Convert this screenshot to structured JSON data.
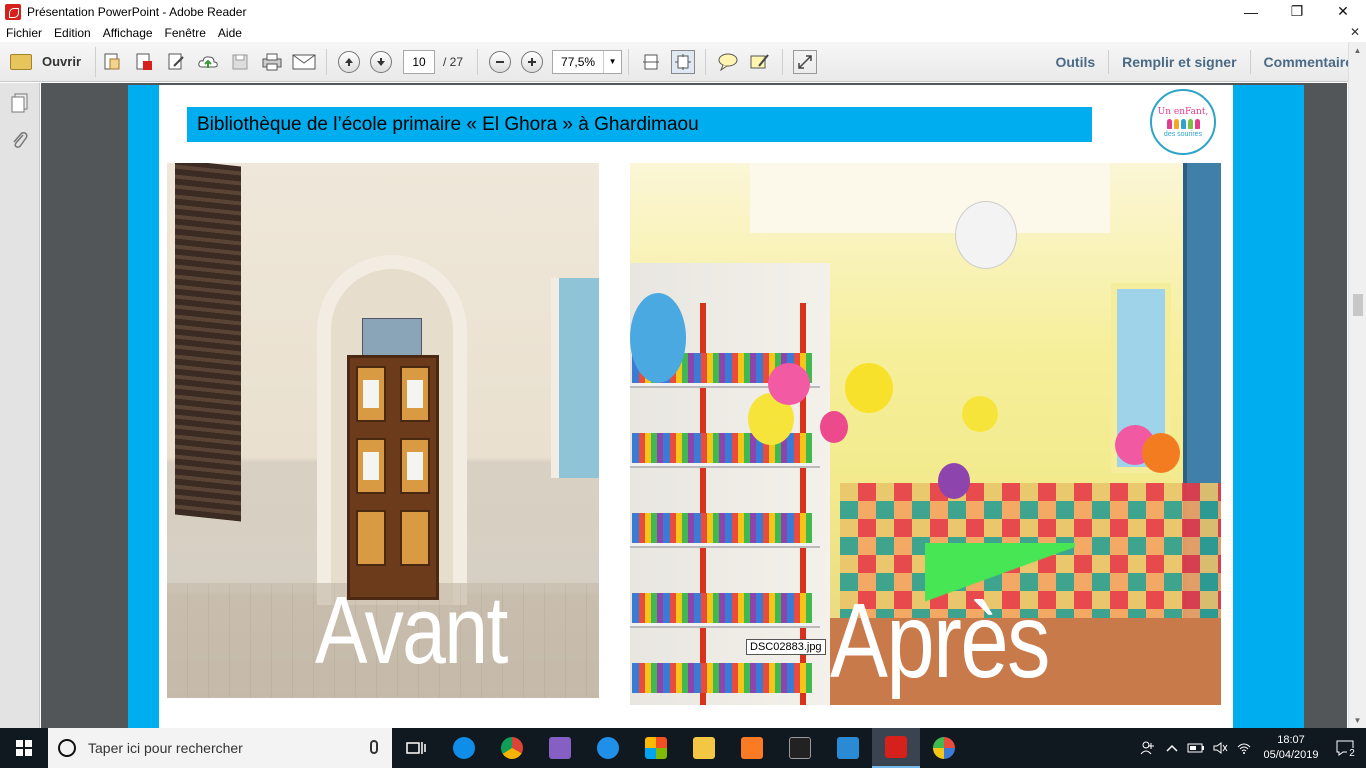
{
  "window": {
    "title": "Présentation PowerPoint - Adobe Reader",
    "minimize": "—",
    "restore": "❐",
    "close": "✕"
  },
  "menu": {
    "items": [
      "Fichier",
      "Edition",
      "Affichage",
      "Fenêtre",
      "Aide"
    ],
    "close_doc": "✕"
  },
  "toolbar": {
    "open_label": "Ouvrir",
    "page_current": "10",
    "page_total": "/ 27",
    "zoom": "77,5%",
    "tools_label": "Outils",
    "fill_sign_label": "Remplir et signer",
    "comment_label": "Commentaire"
  },
  "slide": {
    "title": "Bibliothèque de l’école primaire  « El Ghora »  à Ghardimaou",
    "logo_line1": "Un enFant,",
    "logo_line2": "des sourires",
    "label_before": "Avant",
    "label_after": "Après",
    "tooltip": "DSC02883.jpg"
  },
  "taskbar": {
    "search_placeholder": "Taper ici pour rechercher",
    "time": "18:07",
    "date": "05/04/2019",
    "notifications": "2"
  },
  "colors": {
    "accent_blue": "#00aeef",
    "toolbar_link": "#4a6a87",
    "taskbar_bg": "#101820"
  }
}
